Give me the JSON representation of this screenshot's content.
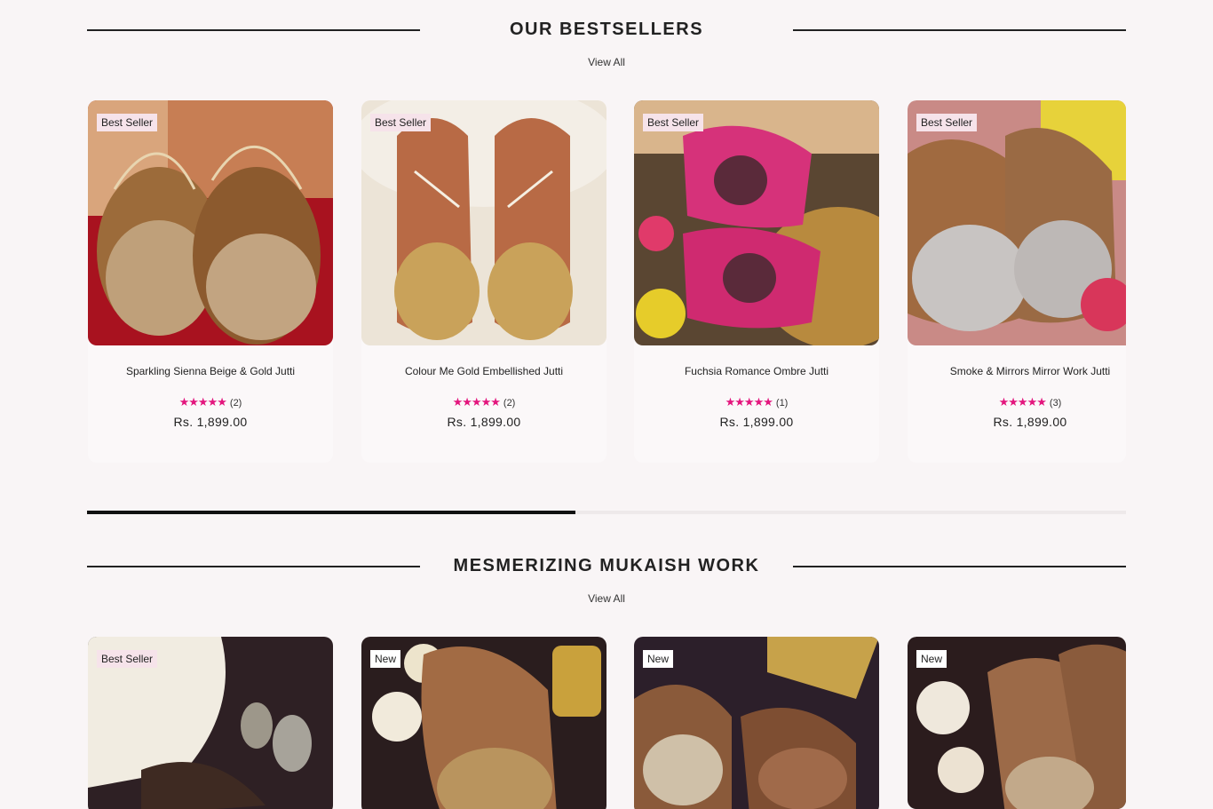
{
  "section1": {
    "title": "OUR BESTSELLERS",
    "view_all": "View All",
    "products": [
      {
        "badge": "Best Seller",
        "name": "Sparkling Sienna Beige & Gold Jutti",
        "stars": "★★★★★",
        "reviews": "(2)",
        "price": "Rs. 1,899.00"
      },
      {
        "badge": "Best Seller",
        "name": "Colour Me Gold Embellished Jutti",
        "stars": "★★★★★",
        "reviews": "(2)",
        "price": "Rs. 1,899.00"
      },
      {
        "badge": "Best Seller",
        "name": "Fuchsia Romance Ombre Jutti",
        "stars": "★★★★★",
        "reviews": "(1)",
        "price": "Rs. 1,899.00"
      },
      {
        "badge": "Best Seller",
        "name": "Smoke & Mirrors Mirror Work Jutti",
        "stars": "★★★★★",
        "reviews": "(3)",
        "price": "Rs. 1,899.00"
      }
    ],
    "scroll_progress": 0.47
  },
  "section2": {
    "title": "MESMERIZING MUKAISH WORK",
    "view_all": "View All",
    "products": [
      {
        "badge": "Best Seller"
      },
      {
        "badge": "New"
      },
      {
        "badge": "New"
      },
      {
        "badge": "New"
      }
    ]
  },
  "colors": {
    "background": "#f9f5f6",
    "star": "#e3157d",
    "badge_best_seller": "#f6e3ea",
    "badge_new": "#ffffff",
    "text": "#222222"
  }
}
